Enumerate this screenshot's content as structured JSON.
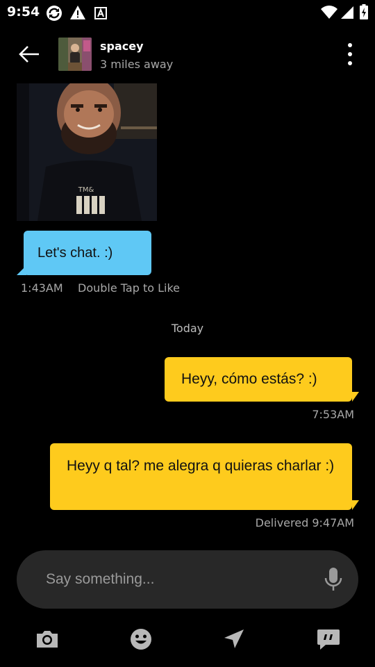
{
  "status_bar": {
    "time": "9:54"
  },
  "header": {
    "contact_name": "spacey",
    "distance": "3 miles away"
  },
  "messages": [
    {
      "direction": "incoming",
      "type": "photo"
    },
    {
      "direction": "incoming",
      "type": "text",
      "text": "Let's chat.  :)",
      "time": "1:43AM",
      "hint": "Double Tap to Like"
    },
    {
      "direction": "outgoing",
      "type": "text",
      "text": "Heyy, cómo estás? :)",
      "time": "7:53AM"
    },
    {
      "direction": "outgoing",
      "type": "text",
      "text": "Heyy q tal? me alegra q quieras charlar :)",
      "time": "Delivered 9:47AM"
    }
  ],
  "date_separator": "Today",
  "composer": {
    "placeholder": "Say something..."
  },
  "toolbar": {
    "icons": [
      "camera-icon",
      "emoji-icon",
      "location-icon",
      "saved-phrases-icon"
    ]
  },
  "colors": {
    "incoming_bubble": "#5fc8f5",
    "outgoing_bubble": "#fecb1d",
    "background": "#000000",
    "composer": "#282828"
  }
}
